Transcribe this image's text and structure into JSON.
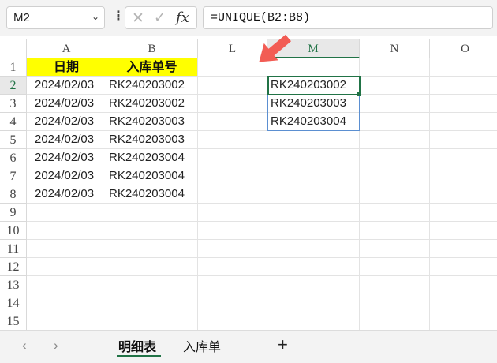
{
  "formula_bar": {
    "name_box": "M2",
    "name_box_arrow": "⌄",
    "separator": "⋮",
    "cancel_icon": "✕",
    "confirm_icon": "✓",
    "fx_label": "fx",
    "formula": "=UNIQUE(B2:B8)"
  },
  "columns": [
    "A",
    "B",
    "L",
    "M",
    "N",
    "O"
  ],
  "rows": [
    "1",
    "2",
    "3",
    "4",
    "5",
    "6",
    "7",
    "8",
    "9",
    "10",
    "11",
    "12",
    "13",
    "14",
    "15"
  ],
  "table": {
    "headers": [
      "日期",
      "入库单号"
    ],
    "data": [
      [
        "2024/02/03",
        "RK240203002"
      ],
      [
        "2024/02/03",
        "RK240203002"
      ],
      [
        "2024/02/03",
        "RK240203003"
      ],
      [
        "2024/02/03",
        "RK240203003"
      ],
      [
        "2024/02/03",
        "RK240203004"
      ],
      [
        "2024/02/03",
        "RK240203004"
      ],
      [
        "2024/02/03",
        "RK240203004"
      ]
    ]
  },
  "unique_results": [
    "RK240203002",
    "RK240203003",
    "RK240203004"
  ],
  "tabs": {
    "prev_icon": "‹",
    "next_icon": "›",
    "items": [
      "明细表",
      "入库单"
    ],
    "active": "明细表",
    "add_label": "+"
  },
  "colors": {
    "accent_green": "#217346",
    "header_yellow": "#ffff00",
    "arrow_red": "#f25c54",
    "spill_border": "#5b8fd1"
  }
}
